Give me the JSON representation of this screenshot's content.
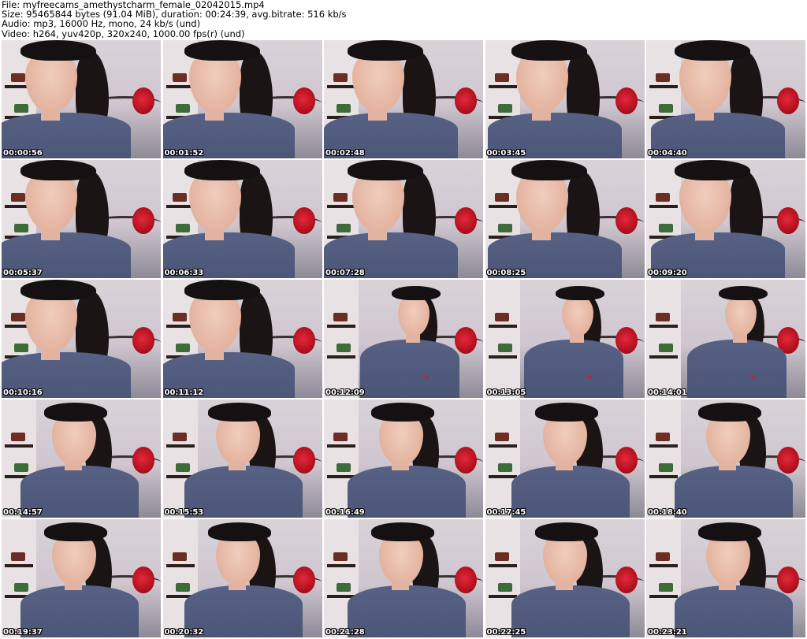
{
  "header": {
    "file_line": "File: myfreecams_amethystcharm_female_02042015.mp4",
    "size_line": "Size: 95465844 bytes (91.04 MiB), duration: 00:24:39, avg.bitrate: 516 kb/s",
    "audio_line": "Audio: mp3, 16000 Hz, mono, 24 kb/s (und)",
    "video_line": "Video: h264, yuv420p, 320x240, 1000.00 fps(r) (und)"
  },
  "thumbnails": [
    {
      "time": "00:00:56",
      "scene": "close"
    },
    {
      "time": "00:01:52",
      "scene": "close"
    },
    {
      "time": "00:02:48",
      "scene": "close"
    },
    {
      "time": "00:03:45",
      "scene": "close"
    },
    {
      "time": "00:04:40",
      "scene": "close"
    },
    {
      "time": "00:05:37",
      "scene": "close"
    },
    {
      "time": "00:06:33",
      "scene": "close"
    },
    {
      "time": "00:07:28",
      "scene": "close"
    },
    {
      "time": "00:08:25",
      "scene": "close"
    },
    {
      "time": "00:09:20",
      "scene": "close"
    },
    {
      "time": "00:10:16",
      "scene": "close"
    },
    {
      "time": "00:11:12",
      "scene": "close"
    },
    {
      "time": "00:12:09",
      "scene": "wide"
    },
    {
      "time": "00:13:05",
      "scene": "wide"
    },
    {
      "time": "00:14:01",
      "scene": "wide"
    },
    {
      "time": "00:14:57",
      "scene": "mid"
    },
    {
      "time": "00:15:53",
      "scene": "mid"
    },
    {
      "time": "00:16:49",
      "scene": "mid"
    },
    {
      "time": "00:17:45",
      "scene": "mid"
    },
    {
      "time": "00:18:40",
      "scene": "mid"
    },
    {
      "time": "00:19:37",
      "scene": "mid"
    },
    {
      "time": "00:20:32",
      "scene": "mid"
    },
    {
      "time": "00:21:28",
      "scene": "mid"
    },
    {
      "time": "00:22:25",
      "scene": "mid"
    },
    {
      "time": "00:23:21",
      "scene": "mid"
    }
  ]
}
